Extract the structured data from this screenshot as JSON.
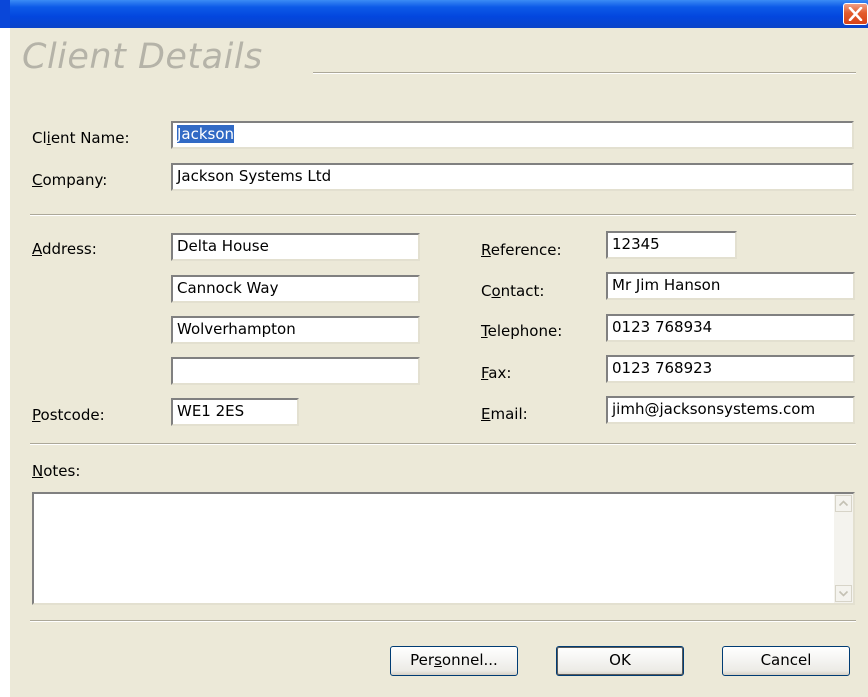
{
  "window": {
    "title": ""
  },
  "heading": "Client Details",
  "client": {
    "name_label": "Client Name:",
    "name_acc": "i",
    "name_value": "Jackson",
    "company_label_acc": "C",
    "company_label_rest": "ompany:",
    "company_value": "Jackson Systems Ltd"
  },
  "address": {
    "label_acc": "A",
    "label_rest": "ddress:",
    "lines": [
      "Delta House",
      "Cannock Way",
      "Wolverhampton",
      ""
    ],
    "postcode_label_acc": "P",
    "postcode_label_rest": "ostcode:",
    "postcode_value": "WE1 2ES"
  },
  "contact": {
    "reference_label_acc": "R",
    "reference_label_rest": "eference:",
    "reference_value": "12345",
    "contact_label_pre": "C",
    "contact_label_acc": "o",
    "contact_label_rest": "ntact:",
    "contact_value": "Mr Jim Hanson",
    "telephone_label_acc": "T",
    "telephone_label_rest": "elephone:",
    "telephone_value": "0123 768934",
    "fax_label_acc": "F",
    "fax_label_rest": "ax:",
    "fax_value": "0123 768923",
    "email_label_acc": "E",
    "email_label_rest": "mail:",
    "email_value": "jimh@jacksonsystems.com"
  },
  "notes": {
    "label_acc": "N",
    "label_rest": "otes:",
    "value": ""
  },
  "buttons": {
    "personnel_pre": "Per",
    "personnel_acc": "s",
    "personnel_rest": "onnel...",
    "ok": "OK",
    "cancel": "Cancel"
  },
  "icons": {
    "close": "close-icon",
    "scroll_up": "chevron-up-icon",
    "scroll_down": "chevron-down-icon"
  },
  "colors": {
    "titlebar": "#0346de",
    "dialog_bg": "#ece9d8",
    "selection": "#316ac5",
    "close": "#e35b2c"
  }
}
